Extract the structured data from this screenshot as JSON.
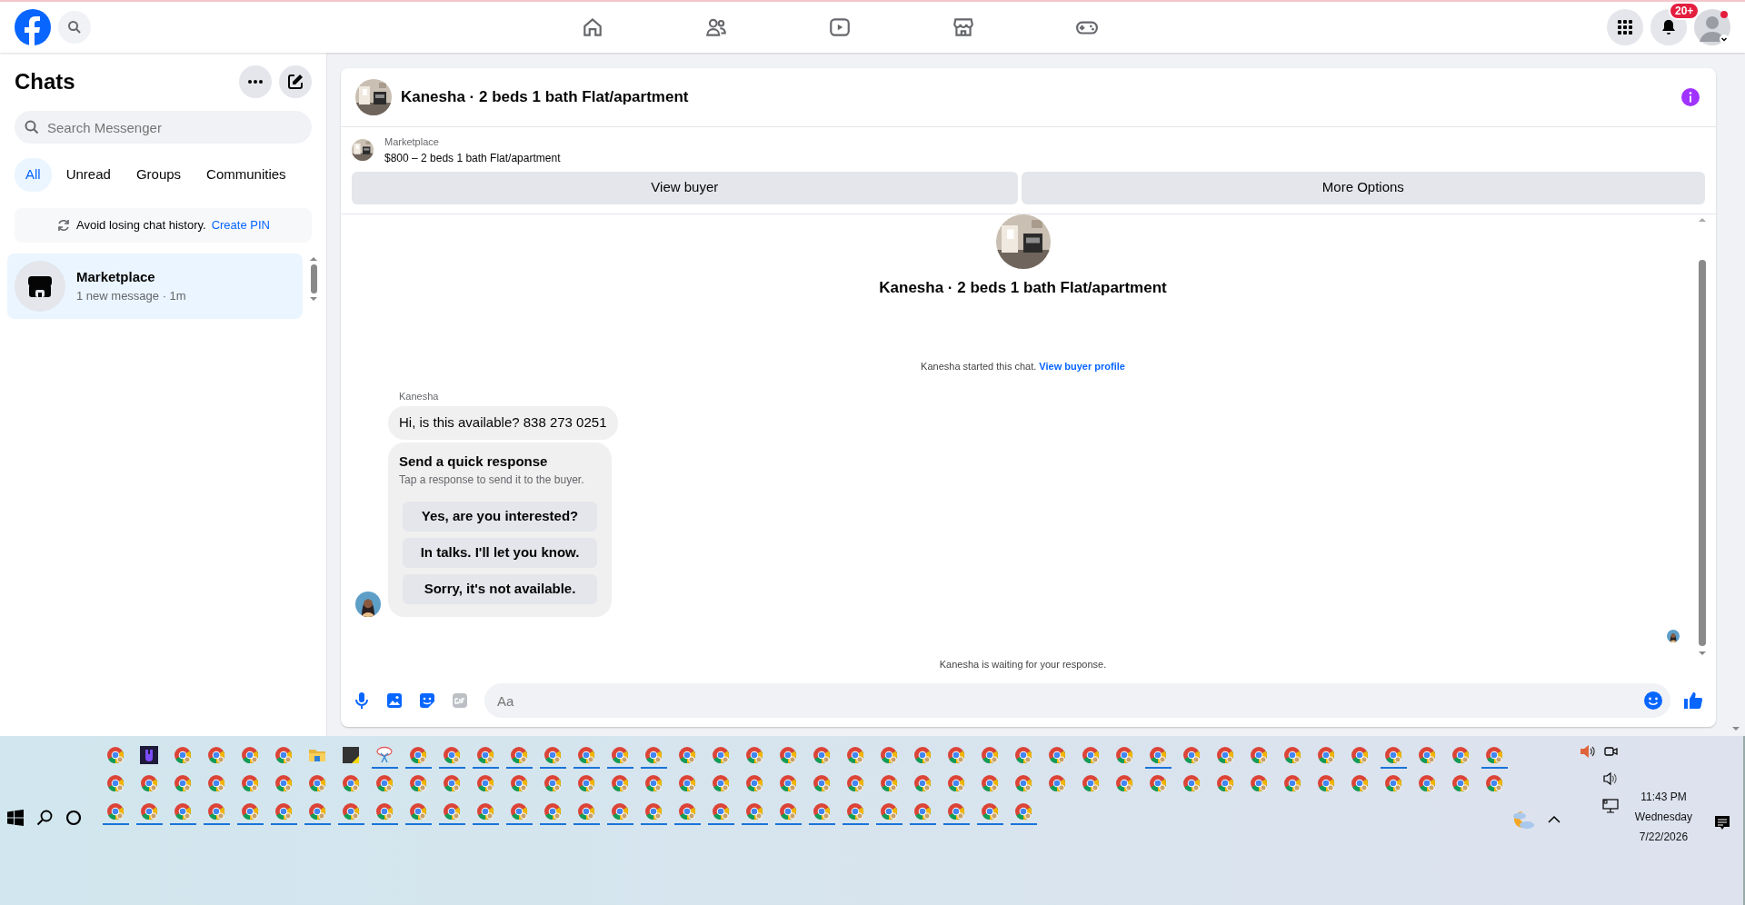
{
  "top_nav": {
    "notification_badge": "20+"
  },
  "sidebar": {
    "title": "Chats",
    "search": {
      "placeholder": "Search Messenger"
    },
    "filters": [
      {
        "label": "All",
        "selected": true
      },
      {
        "label": "Unread",
        "selected": false
      },
      {
        "label": "Groups",
        "selected": false
      },
      {
        "label": "Communities",
        "selected": false
      }
    ],
    "notice": {
      "text": "Avoid losing chat history.",
      "link": "Create PIN"
    },
    "chats": [
      {
        "name": "Marketplace",
        "preview": "1 new message · 1m",
        "selected": true
      }
    ]
  },
  "conversation": {
    "title": "Kanesha · 2 beds 1 bath Flat/apartment",
    "listing": {
      "source": "Marketplace",
      "summary": "$800 – 2 beds 1 bath Flat/apartment"
    },
    "actions": [
      "View buyer",
      "More Options"
    ],
    "intro_title": "Kanesha · 2 beds 1 bath Flat/apartment",
    "started": {
      "text": "Kanesha started this chat.",
      "link": "View buyer profile"
    },
    "messages": [
      {
        "sender": "Kanesha",
        "text": "Hi, is this available? 838 273 0251"
      }
    ],
    "quick_response": {
      "title": "Send a quick response",
      "hint": "Tap a response to send it to the buyer.",
      "options": [
        "Yes, are you interested?",
        "In talks. I'll let you know.",
        "Sorry, it's not available."
      ]
    },
    "status": "Kanesha is waiting for your response.",
    "composer": {
      "placeholder": "Aa"
    }
  },
  "taskbar": {
    "rows": [
      [
        {
          "kind": "chrome",
          "running": false
        },
        {
          "kind": "app",
          "running": false
        },
        {
          "kind": "chrome",
          "running": false
        },
        {
          "kind": "chrome",
          "running": false
        },
        {
          "kind": "chrome",
          "running": false
        },
        {
          "kind": "chrome",
          "running": false
        },
        {
          "kind": "folder",
          "running": false
        },
        {
          "kind": "notes",
          "running": false
        },
        {
          "kind": "snip",
          "running": true
        },
        {
          "kind": "chrome",
          "running": true
        },
        {
          "kind": "chrome",
          "running": true
        },
        {
          "kind": "chrome",
          "running": true
        },
        {
          "kind": "chrome",
          "running": true
        },
        {
          "kind": "chrome",
          "running": true
        },
        {
          "kind": "chrome",
          "running": true
        },
        {
          "kind": "chrome",
          "running": true
        },
        {
          "kind": "chrome",
          "running": true
        },
        {
          "kind": "chrome",
          "running": false
        },
        {
          "kind": "chrome",
          "running": false
        },
        {
          "kind": "chrome",
          "running": false
        },
        {
          "kind": "chrome",
          "running": false
        },
        {
          "kind": "chrome",
          "running": false
        },
        {
          "kind": "chrome",
          "running": false
        },
        {
          "kind": "chrome",
          "running": false
        },
        {
          "kind": "chrome",
          "running": false
        },
        {
          "kind": "chrome",
          "running": false
        },
        {
          "kind": "chrome",
          "running": false
        },
        {
          "kind": "chrome",
          "running": false
        },
        {
          "kind": "chrome",
          "running": false
        },
        {
          "kind": "chrome",
          "running": false
        },
        {
          "kind": "chrome",
          "running": false
        },
        {
          "kind": "chrome",
          "running": true
        },
        {
          "kind": "chrome",
          "running": false
        },
        {
          "kind": "chrome",
          "running": false
        },
        {
          "kind": "chrome",
          "running": false
        },
        {
          "kind": "chrome",
          "running": false
        },
        {
          "kind": "chrome",
          "running": false
        },
        {
          "kind": "chrome",
          "running": false
        },
        {
          "kind": "chrome",
          "running": true
        },
        {
          "kind": "chrome",
          "running": false
        },
        {
          "kind": "chrome",
          "running": false
        },
        {
          "kind": "chrome",
          "running": true
        }
      ],
      [
        {
          "kind": "chrome",
          "running": false
        },
        {
          "kind": "chrome",
          "running": false
        },
        {
          "kind": "chrome",
          "running": false
        },
        {
          "kind": "chrome",
          "running": false
        },
        {
          "kind": "chrome",
          "running": false
        },
        {
          "kind": "chrome",
          "running": false
        },
        {
          "kind": "chrome",
          "running": false
        },
        {
          "kind": "chrome",
          "running": false
        },
        {
          "kind": "chrome",
          "running": false
        },
        {
          "kind": "chrome",
          "running": false
        },
        {
          "kind": "chrome",
          "running": false
        },
        {
          "kind": "chrome",
          "running": false
        },
        {
          "kind": "chrome",
          "running": false
        },
        {
          "kind": "chrome",
          "running": false
        },
        {
          "kind": "chrome",
          "running": false
        },
        {
          "kind": "chrome",
          "running": false
        },
        {
          "kind": "chrome",
          "running": false
        },
        {
          "kind": "chrome",
          "running": false
        },
        {
          "kind": "chrome",
          "running": false
        },
        {
          "kind": "chrome",
          "running": false
        },
        {
          "kind": "chrome",
          "running": false
        },
        {
          "kind": "chrome",
          "running": false
        },
        {
          "kind": "chrome",
          "running": false
        },
        {
          "kind": "chrome",
          "running": false
        },
        {
          "kind": "chrome",
          "running": false
        },
        {
          "kind": "chrome",
          "running": false
        },
        {
          "kind": "chrome",
          "running": false
        },
        {
          "kind": "chrome",
          "running": false
        },
        {
          "kind": "chrome",
          "running": false
        },
        {
          "kind": "chrome",
          "running": false
        },
        {
          "kind": "chrome",
          "running": false
        },
        {
          "kind": "chrome",
          "running": false
        },
        {
          "kind": "chrome",
          "running": false
        },
        {
          "kind": "chrome",
          "running": false
        },
        {
          "kind": "chrome",
          "running": false
        },
        {
          "kind": "chrome",
          "running": false
        },
        {
          "kind": "chrome",
          "running": false
        },
        {
          "kind": "chrome",
          "running": false
        },
        {
          "kind": "chrome",
          "running": false
        },
        {
          "kind": "chrome",
          "running": false
        },
        {
          "kind": "chrome",
          "running": false
        },
        {
          "kind": "chrome",
          "running": false
        }
      ],
      [
        {
          "kind": "chrome",
          "running": true
        },
        {
          "kind": "chrome",
          "running": true
        },
        {
          "kind": "chrome",
          "running": true
        },
        {
          "kind": "chrome",
          "running": true
        },
        {
          "kind": "chrome",
          "running": true
        },
        {
          "kind": "chrome",
          "running": true
        },
        {
          "kind": "chrome",
          "running": true
        },
        {
          "kind": "chrome",
          "running": true
        },
        {
          "kind": "chrome",
          "running": true
        },
        {
          "kind": "chrome",
          "running": true
        },
        {
          "kind": "chrome",
          "running": true
        },
        {
          "kind": "chrome",
          "running": true
        },
        {
          "kind": "chrome",
          "running": true
        },
        {
          "kind": "chrome",
          "running": true
        },
        {
          "kind": "chrome",
          "running": true
        },
        {
          "kind": "chrome",
          "running": true
        },
        {
          "kind": "chrome",
          "running": true
        },
        {
          "kind": "chrome",
          "running": true
        },
        {
          "kind": "chrome",
          "running": true
        },
        {
          "kind": "chrome",
          "running": true
        },
        {
          "kind": "chrome",
          "running": true
        },
        {
          "kind": "chrome",
          "running": true
        },
        {
          "kind": "chrome",
          "running": true
        },
        {
          "kind": "chrome",
          "running": true
        },
        {
          "kind": "chrome",
          "running": true
        },
        {
          "kind": "chrome",
          "running": true
        },
        {
          "kind": "chrome",
          "running": true
        },
        {
          "kind": "chrome",
          "running": true
        }
      ]
    ],
    "clock": {
      "time": "11:43 PM",
      "day": "Wednesday",
      "date": "7/22/2026"
    }
  }
}
